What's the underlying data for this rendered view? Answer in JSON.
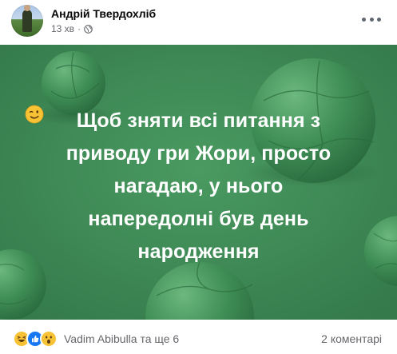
{
  "post": {
    "author": "Андрій Твердохліб",
    "time": "13 хв",
    "separator": "·",
    "audience_icon": "globe-icon",
    "more_icon": "more-options-icon"
  },
  "image": {
    "background_color": "#3d8a55",
    "text_lines": [
      "Щоб зняти всі питання з",
      "приводу гри Жори, просто",
      "нагадаю, у нього",
      "напередолні був день",
      "народження"
    ],
    "emoji_icon": "winking-face-icon"
  },
  "footer": {
    "reaction_icons": [
      "haha-reaction-icon",
      "like-reaction-icon",
      "wow-reaction-icon"
    ],
    "reactors": "Vadim Abibulla та ще 6",
    "comments": "2 коментарі"
  }
}
